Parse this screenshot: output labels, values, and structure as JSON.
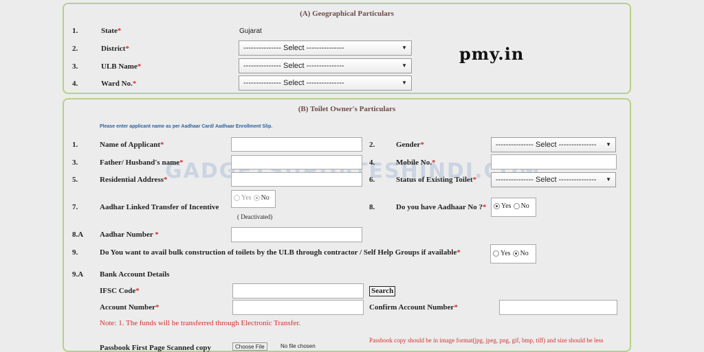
{
  "sectionA": {
    "title": "(A) Geographical Particulars",
    "rows": [
      {
        "num": "1.",
        "label": "State",
        "value": "Gujarat"
      },
      {
        "num": "2.",
        "label": "District",
        "select": "--------------- Select ---------------"
      },
      {
        "num": "3.",
        "label": "ULB Name",
        "select": "--------------- Select ---------------"
      },
      {
        "num": "4.",
        "label": "Ward No.",
        "select": "--------------- Select ---------------"
      }
    ],
    "required_mark": "*"
  },
  "logo_text": "pmy.in",
  "watermark": "GADGETSUPDATESHINDI.COM",
  "sectionB": {
    "title": "(B) Toilet Owner's Particulars",
    "hint": "Please enter applicant name as per Aadhaar Card/ Aadhaar Enrollment Slip.",
    "left": [
      {
        "num": "1.",
        "label": "Name of Applicant"
      },
      {
        "num": "3.",
        "label": "Father/ Husband's name"
      },
      {
        "num": "5.",
        "label": "Residential Address"
      },
      {
        "num": "7.",
        "label": "Aadhar Linked Transfer of Incentive"
      }
    ],
    "right": [
      {
        "num": "2.",
        "label": "Gender",
        "select": "--------------- Select ---------------"
      },
      {
        "num": "4.",
        "label": "Mobile No."
      },
      {
        "num": "6.",
        "label": "Status of Existing Toilet",
        "select": "--------------- Select ---------------"
      },
      {
        "num": "8.",
        "label": "Do you have Aadhaar No ?"
      }
    ],
    "yes": "Yes",
    "no": "No",
    "deactivated": "( Deactivated)",
    "aadhar_num": "8.A",
    "aadhar_label": "Aadhar Number",
    "bulk_num": "9.",
    "bulk_label": "Do You want to avail bulk construction of toilets by the ULB through contractor / Self Help Groups if available",
    "bank_num": "9.A",
    "bank_label": "Bank Account Details",
    "ifsc_label": "IFSC Code",
    "search_label": "Search",
    "account_label": "Account Number",
    "confirm_label": "Confirm Account Number",
    "note": "Note: 1. The funds will be transferred through Electronic Transfer.",
    "passbook_note": "Passbook copy should be in image format(jpg, jpeg, png, gif, bmp, tiff) and size should be less",
    "upload_label": "Passbook First Page Scanned copy",
    "choose_file": "Choose File",
    "no_file": "No file chosen"
  }
}
